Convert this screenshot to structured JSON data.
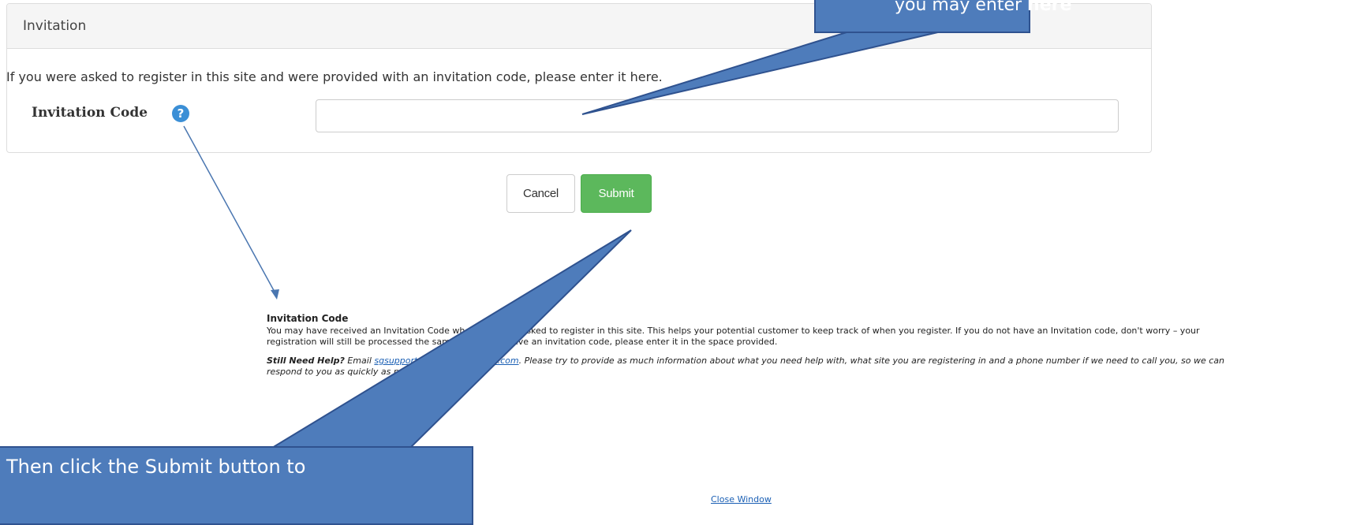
{
  "panel": {
    "title": "Invitation",
    "intro": "If you were asked to register in this site and were provided with an invitation code, please enter it here.",
    "field_label": "Invitation Code",
    "help_icon": "question-circle-icon",
    "input_value": "",
    "input_placeholder": ""
  },
  "buttons": {
    "cancel": "Cancel",
    "submit": "Submit"
  },
  "help": {
    "title": "Invitation Code",
    "body": "You may have received an Invitation Code when you were asked to register in this site.  This helps your potential customer to keep track of when you register.  If you do not have an Invitation code, don't worry – your registration will still be processed the same way.  If you have an invitation code, please enter it in the space provided.",
    "still_need_help_label": "Still Need Help?",
    "still_need_help_pre": " Email ",
    "support_email": "sgsupport@suppliergateway.com",
    "still_need_help_post": ". Please try to provide as much information about what you need help with, what site you are registering in and a phone number if we need to call you, so we can respond to you as quickly as possible.",
    "close_window": "Close Window"
  },
  "callouts": {
    "top_text_pre": "you may enter ",
    "top_text_bold": "here",
    "bottom_text": "Then click the Submit button to"
  },
  "colors": {
    "callout_fill": "#4e7cbb",
    "callout_border": "#2f528f",
    "submit_green": "#5cb85c",
    "help_blue": "#3b8fd6"
  }
}
